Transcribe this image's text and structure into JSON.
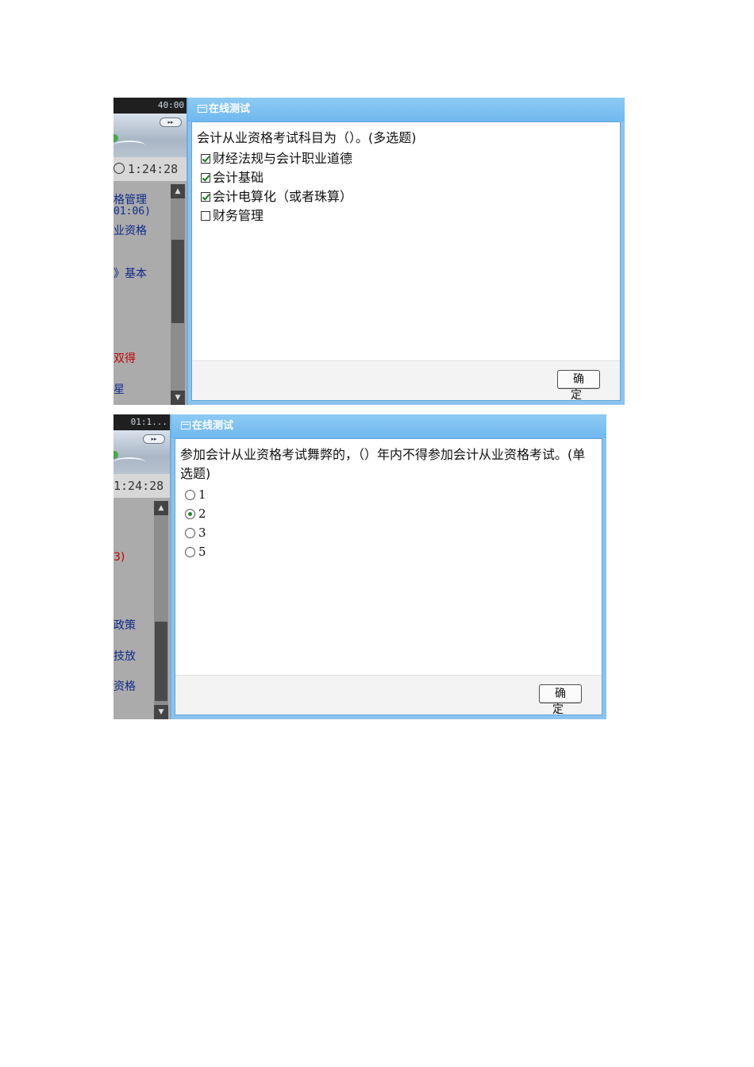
{
  "dialog1": {
    "title": "在线测试",
    "question": "会计从业资格考试科目为（）。(多选题)",
    "options": [
      {
        "label": "财经法规与会计职业道德",
        "checked": true
      },
      {
        "label": "会计基础",
        "checked": true
      },
      {
        "label": "会计电算化（或者珠算）",
        "checked": true
      },
      {
        "label": "财务管理",
        "checked": false
      }
    ],
    "confirm_label": "确 定"
  },
  "sidebar1": {
    "countdown": "40:00",
    "ff_label": "▸▸",
    "elapsed": "1:24:28",
    "fragments": [
      "格管理",
      "01:06)",
      "业资格",
      "》基本",
      "双得",
      "星"
    ]
  },
  "dialog2": {
    "title": "在线测试",
    "question": "参加会计从业资格考试舞弊的，（）年内不得参加会计从业资格考试。(单选题)",
    "options": [
      {
        "label": "1",
        "checked": false
      },
      {
        "label": "2",
        "checked": true
      },
      {
        "label": "3",
        "checked": false
      },
      {
        "label": "5",
        "checked": false
      }
    ],
    "confirm_label": "确 定"
  },
  "sidebar2": {
    "countdown": "01:1...",
    "ff_label": "▸▸",
    "elapsed": "1:24:28",
    "fragments": [
      "3)",
      "政策",
      "技放",
      "资格"
    ]
  },
  "colors": {
    "dialog_frame": "#8cc3ee",
    "titlebar": "#6fb8ef",
    "check_green": "#167a1b",
    "link_blue": "#0c2a8a",
    "link_red": "#c00000"
  }
}
